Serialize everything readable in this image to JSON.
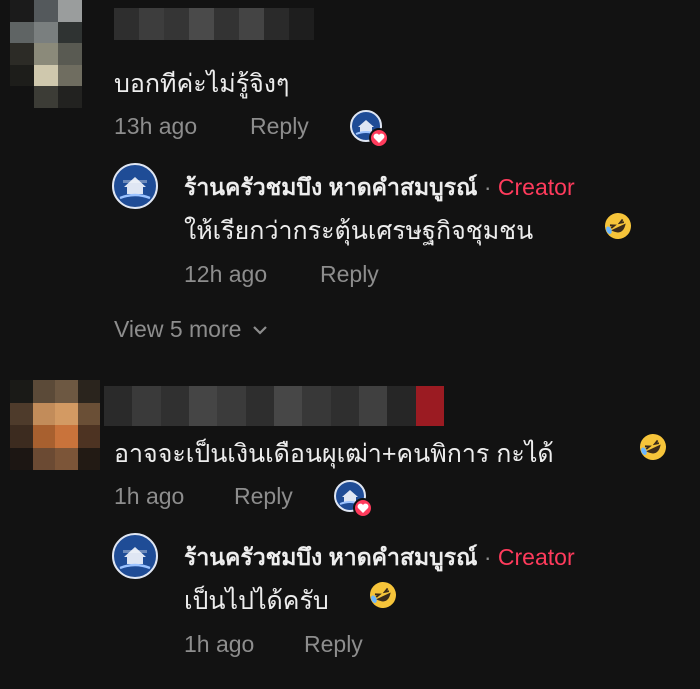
{
  "comments": [
    {
      "text": "บอกทีค่ะไม่รู้จิงๆ",
      "time": "13h ago",
      "reply_label": "Reply",
      "reply": {
        "author": "ร้านครัวชมบึง หาดคำสมบูรณ์",
        "separator": "·",
        "badge": "Creator",
        "text": "ให้เรียกว่ากระตุ้นเศรษฐกิจชุมชน",
        "time": "12h ago",
        "reply_label": "Reply"
      },
      "view_more": "View 5 more"
    },
    {
      "text": "อาจจะเป็นเงินเดือนผุเฒ่า+คนพิการ กะได้",
      "time": "1h ago",
      "reply_label": "Reply",
      "reply": {
        "author": "ร้านครัวชมบึง หาดคำสมบูรณ์",
        "separator": "·",
        "badge": "Creator",
        "text": "เป็นไปได้ครับ",
        "time": "1h ago",
        "reply_label": "Reply"
      }
    }
  ],
  "icons": {
    "liked_by_creator": "heart-icon",
    "laugh_emoji": "rolling-on-floor-laughing-emoji",
    "view_more_chevron": "chevron-down-icon"
  },
  "colors": {
    "background": "#121212",
    "creator_badge": "#ff3b5c",
    "meta_text": "#8d8d8d",
    "logo_blue": "#1f4c96"
  }
}
